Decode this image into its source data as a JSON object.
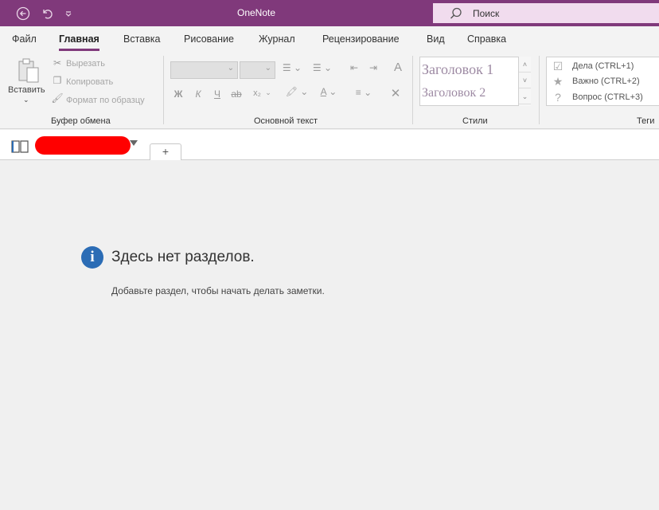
{
  "app": {
    "title": "OneNote"
  },
  "search": {
    "placeholder": "Поиск"
  },
  "tabs": [
    {
      "label": "Файл"
    },
    {
      "label": "Главная"
    },
    {
      "label": "Вставка"
    },
    {
      "label": "Рисование"
    },
    {
      "label": "Журнал"
    },
    {
      "label": "Рецензирование"
    },
    {
      "label": "Вид"
    },
    {
      "label": "Справка"
    }
  ],
  "clipboard": {
    "paste": "Вставить",
    "cut": "Вырезать",
    "copy": "Копировать",
    "format_painter": "Формат по образцу",
    "group_label": "Буфер обмена"
  },
  "basic_text": {
    "bold": "Ж",
    "italic": "К",
    "underline": "Ч",
    "strike": "ab",
    "subscript": "x₂",
    "group_label": "Основной текст"
  },
  "styles": {
    "items": [
      "Заголовок 1",
      "Заголовок 2"
    ],
    "group_label": "Стили"
  },
  "tags": {
    "items": [
      "Дела (CTRL+1)",
      "Важно (CTRL+2)",
      "Вопрос (CTRL+3)"
    ],
    "group_label": "Теги"
  },
  "notebook": {
    "add_section": "+"
  },
  "empty_state": {
    "title": "Здесь нет разделов.",
    "message": "Добавьте раздел, чтобы начать делать заметки."
  },
  "colors": {
    "accent": "#80397b",
    "search_bg": "#f1dcee",
    "info_blue": "#2b6cb5",
    "redaction": "#ff0000"
  }
}
